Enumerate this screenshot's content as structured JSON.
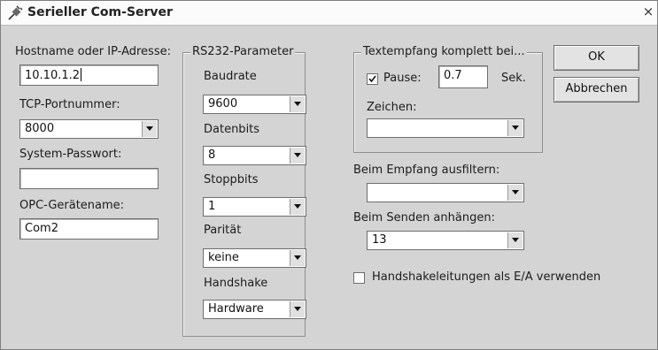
{
  "window": {
    "title": "Serieller Com-Server",
    "close_glyph": "×",
    "icon": "plug-icon"
  },
  "left": {
    "hostname_label": "Hostname oder IP-Adresse:",
    "hostname_value": "10.10.1.2",
    "tcp_label": "TCP-Portnummer:",
    "tcp_value": "8000",
    "password_label": "System-Passwort:",
    "password_value": "",
    "opc_label": "OPC-Gerätename:",
    "opc_value": "Com2"
  },
  "rs232": {
    "title": "RS232-Parameter",
    "baud_label": "Baudrate",
    "baud_value": "9600",
    "databits_label": "Datenbits",
    "databits_value": "8",
    "stopbits_label": "Stoppbits",
    "stopbits_value": "1",
    "parity_label": "Parität",
    "parity_value": "keine",
    "handshake_label": "Handshake",
    "handshake_value": "Hardware"
  },
  "text_receive": {
    "title": "Textempfang komplett bei...",
    "pause_label": "Pause:",
    "pause_checked": true,
    "pause_value": "0.7",
    "pause_unit": "Sek.",
    "chars_label": "Zeichen:",
    "chars_value": ""
  },
  "filter": {
    "label": "Beim Empfang ausfiltern:",
    "value": ""
  },
  "append": {
    "label": "Beim Senden anhängen:",
    "value": "13"
  },
  "handshake_io": {
    "label": "Handshakeleitungen als E/A verwenden",
    "checked": false
  },
  "buttons": {
    "ok": "OK",
    "cancel": "Abbrechen"
  }
}
